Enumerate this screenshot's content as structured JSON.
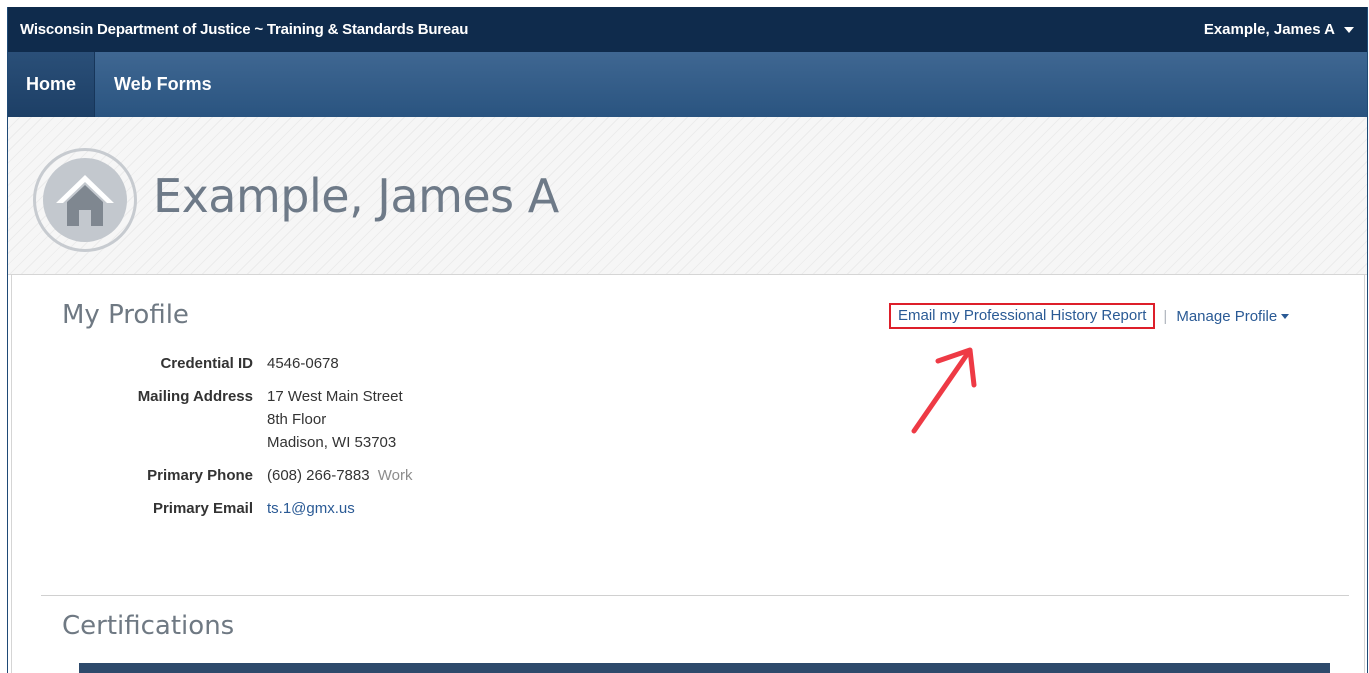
{
  "topbar": {
    "title": "Wisconsin Department of Justice ~ Training & Standards Bureau",
    "user_name": "Example, James A",
    "user_menu_icon": "caret-down-icon"
  },
  "nav": {
    "items": [
      {
        "label": "Home",
        "active": true
      },
      {
        "label": "Web Forms",
        "active": false
      }
    ]
  },
  "hero": {
    "icon": "home-icon",
    "name": "Example, James A"
  },
  "profile": {
    "title": "My Profile",
    "email_report_label": "Email my Professional History Report",
    "separator": "|",
    "manage_label": "Manage Profile",
    "fields": {
      "credential_id_label": "Credential ID",
      "credential_id": "4546-0678",
      "mailing_address_label": "Mailing Address",
      "address_line1": "17 West Main Street",
      "address_line2": "8th Floor",
      "address_line3": "Madison, WI 53703",
      "primary_phone_label": "Primary Phone",
      "primary_phone": "(608) 266-7883",
      "primary_phone_type": "Work",
      "primary_email_label": "Primary Email",
      "primary_email": "ts.1@gmx.us"
    }
  },
  "certifications": {
    "title": "Certifications"
  },
  "colors": {
    "topbar_bg": "#0f2b4c",
    "navbar_bg": "#2a5480",
    "link": "#2a5a95",
    "highlight_box": "#dd1f2a",
    "annotation_arrow": "#ee3a45"
  }
}
